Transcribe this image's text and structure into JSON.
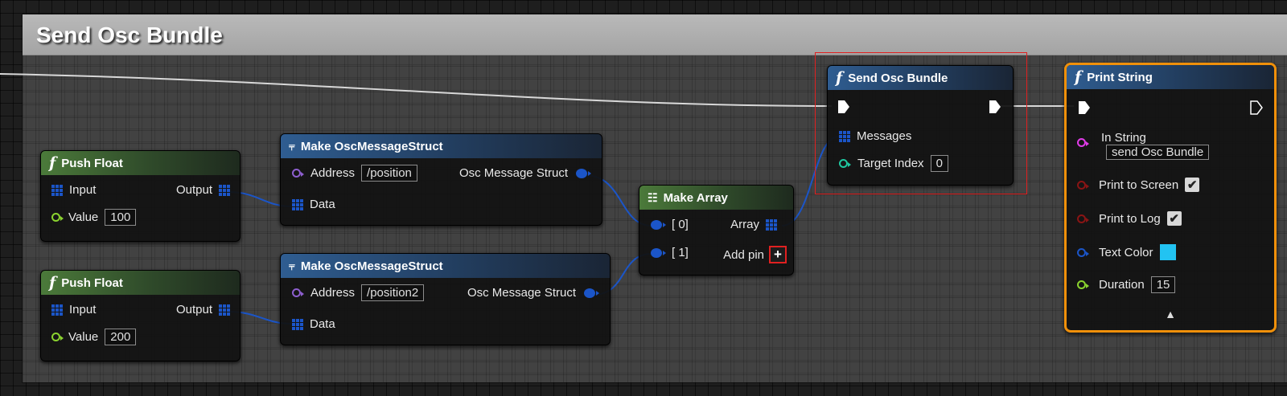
{
  "comment": {
    "title": "Send Osc Bundle"
  },
  "colors": {
    "exec": "#ffffff",
    "struct_pin": "#1b55c8",
    "array_pin": "#1b55c8",
    "int_pin": "#1fc7a0",
    "float_pin": "#8bd32f",
    "string_pin": "#e03ce8",
    "address_pin": "#8e5fcf",
    "bool_pin": "#8a1414",
    "color_pin": "#1b55c8",
    "selection": "#e02020",
    "print_string_outline": "#f0900a",
    "text_color_swatch": "#22c3f2"
  },
  "nodes": {
    "push_float_1": {
      "title": "Push Float",
      "icon": "function-icon",
      "input_label": "Input",
      "output_label": "Output",
      "value_label": "Value",
      "value": "100"
    },
    "push_float_2": {
      "title": "Push Float",
      "icon": "function-icon",
      "input_label": "Input",
      "output_label": "Output",
      "value_label": "Value",
      "value": "200"
    },
    "make_osc_1": {
      "title": "Make OscMessageStruct",
      "icon": "make-struct-icon",
      "address_label": "Address",
      "address_value": "/position",
      "output_label": "Osc Message Struct",
      "data_label": "Data"
    },
    "make_osc_2": {
      "title": "Make OscMessageStruct",
      "icon": "make-struct-icon",
      "address_label": "Address",
      "address_value": "/position2",
      "output_label": "Osc Message Struct",
      "data_label": "Data"
    },
    "make_array": {
      "title": "Make Array",
      "icon": "make-array-icon",
      "pin0_label": "[ 0]",
      "pin1_label": "[ 1]",
      "output_label": "Array",
      "add_pin_label": "Add pin",
      "add_pin_glyph": "+"
    },
    "send_osc_bundle": {
      "title": "Send Osc Bundle",
      "icon": "function-icon",
      "messages_label": "Messages",
      "target_index_label": "Target Index",
      "target_index_value": "0"
    },
    "print_string": {
      "title": "Print String",
      "icon": "function-icon",
      "in_string_label": "In String",
      "in_string_value": "send Osc Bundle",
      "print_to_screen_label": "Print to Screen",
      "print_to_screen": true,
      "print_to_log_label": "Print to Log",
      "print_to_log": true,
      "text_color_label": "Text Color",
      "duration_label": "Duration",
      "duration_value": "15",
      "expander_glyph": "▲",
      "checkmark": "✔"
    }
  }
}
